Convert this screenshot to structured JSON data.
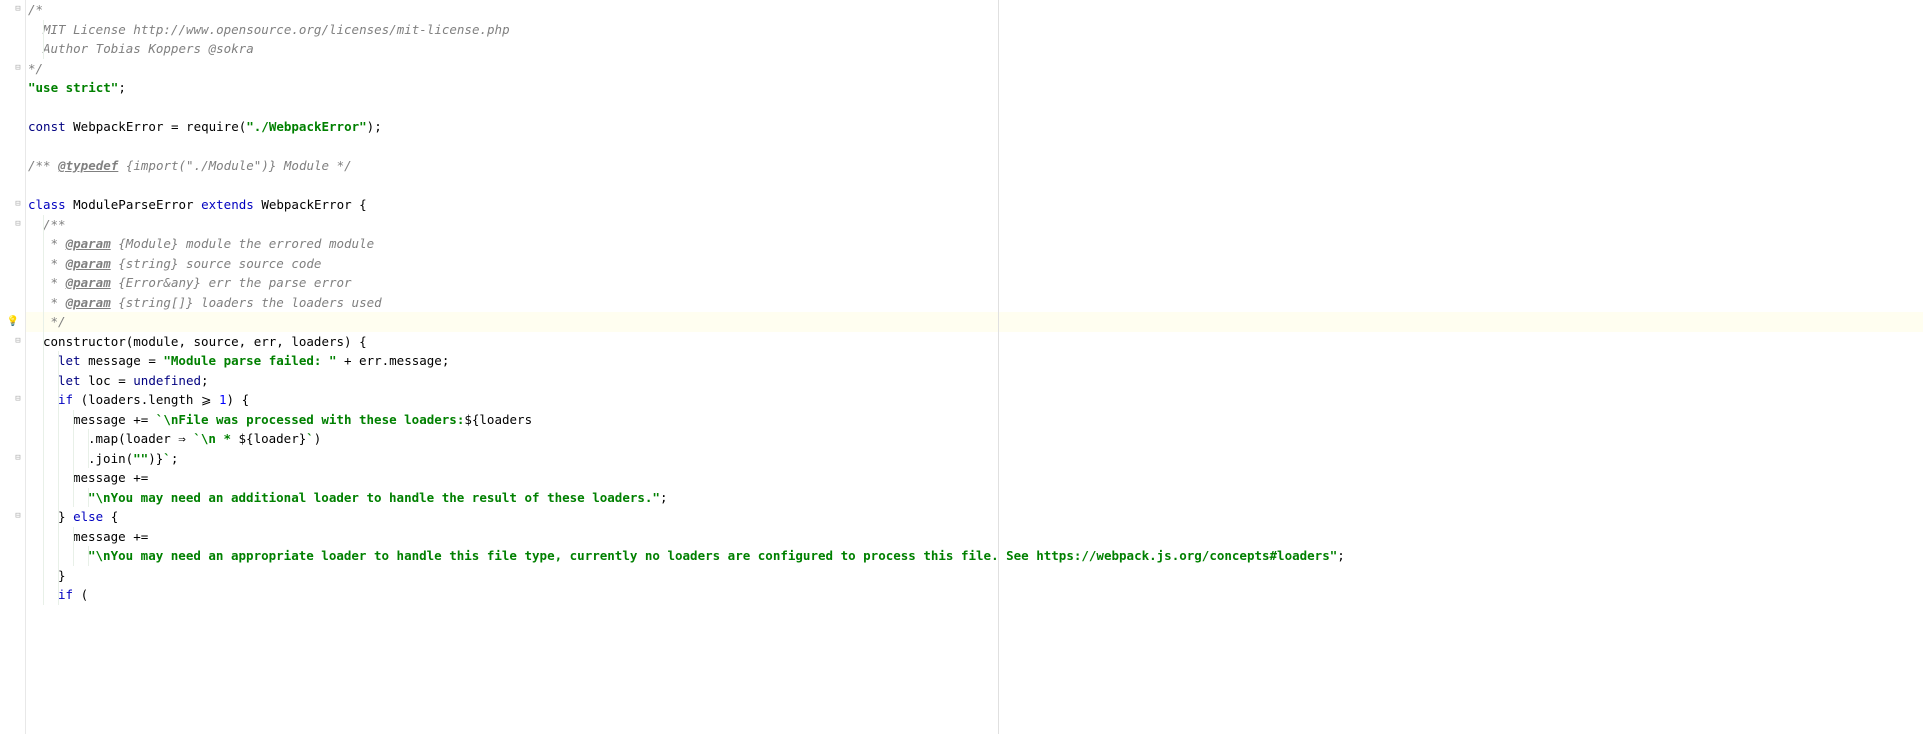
{
  "gutter_bulb_line": 16,
  "lines": [
    {
      "indent": 0,
      "fold": true,
      "tokens": [
        {
          "t": "/*",
          "c": "c-comment"
        }
      ]
    },
    {
      "indent": 1,
      "tokens": [
        {
          "t": "MIT License http://www.opensource.org/licenses/mit-license.php",
          "c": "c-comment"
        }
      ]
    },
    {
      "indent": 1,
      "tokens": [
        {
          "t": "Author Tobias Koppers @sokra",
          "c": "c-comment"
        }
      ]
    },
    {
      "indent": 0,
      "fold": true,
      "tokens": [
        {
          "t": "*/",
          "c": "c-comment"
        }
      ]
    },
    {
      "indent": 0,
      "tokens": [
        {
          "t": "\"use strict\"",
          "c": "c-string"
        },
        {
          "t": ";",
          "c": "c-normal"
        }
      ]
    },
    {
      "indent": 0,
      "tokens": []
    },
    {
      "indent": 0,
      "tokens": [
        {
          "t": "const ",
          "c": "c-keyword2"
        },
        {
          "t": "WebpackError = require(",
          "c": "c-normal"
        },
        {
          "t": "\"./WebpackError\"",
          "c": "c-string"
        },
        {
          "t": ");",
          "c": "c-normal"
        }
      ]
    },
    {
      "indent": 0,
      "tokens": []
    },
    {
      "indent": 0,
      "tokens": [
        {
          "t": "/** ",
          "c": "c-doc"
        },
        {
          "t": "@typedef",
          "c": "c-doctag"
        },
        {
          "t": " {import(\"./Module\")} Module */",
          "c": "c-doc"
        }
      ]
    },
    {
      "indent": 0,
      "tokens": []
    },
    {
      "indent": 0,
      "fold": true,
      "tokens": [
        {
          "t": "class ",
          "c": "c-keyword"
        },
        {
          "t": "ModuleParseError ",
          "c": "c-normal"
        },
        {
          "t": "extends ",
          "c": "c-keyword"
        },
        {
          "t": "WebpackError {",
          "c": "c-normal"
        }
      ]
    },
    {
      "indent": 1,
      "fold": true,
      "tokens": [
        {
          "t": "/**",
          "c": "c-doc"
        }
      ]
    },
    {
      "indent": 1,
      "tokens": [
        {
          "t": " * ",
          "c": "c-doc"
        },
        {
          "t": "@param",
          "c": "c-doctag"
        },
        {
          "t": " {Module} module ",
          "c": "c-doc"
        },
        {
          "t": "the errored module",
          "c": "c-docparam"
        }
      ]
    },
    {
      "indent": 1,
      "tokens": [
        {
          "t": " * ",
          "c": "c-doc"
        },
        {
          "t": "@param",
          "c": "c-doctag"
        },
        {
          "t": " {string} source ",
          "c": "c-doc"
        },
        {
          "t": "source code",
          "c": "c-docparam"
        }
      ]
    },
    {
      "indent": 1,
      "tokens": [
        {
          "t": " * ",
          "c": "c-doc"
        },
        {
          "t": "@param",
          "c": "c-doctag"
        },
        {
          "t": " {Error&any} err ",
          "c": "c-doc"
        },
        {
          "t": "the parse error",
          "c": "c-docparam"
        }
      ]
    },
    {
      "indent": 1,
      "tokens": [
        {
          "t": " * ",
          "c": "c-doc"
        },
        {
          "t": "@param",
          "c": "c-doctag"
        },
        {
          "t": " {string[]} loaders ",
          "c": "c-doc"
        },
        {
          "t": "the loaders used",
          "c": "c-docparam"
        }
      ]
    },
    {
      "indent": 1,
      "highlight": true,
      "bulb": true,
      "tokens": [
        {
          "t": " */",
          "c": "c-doc"
        }
      ]
    },
    {
      "indent": 1,
      "fold": true,
      "tokens": [
        {
          "t": "constructor(module, source, err, loaders) {",
          "c": "c-normal"
        }
      ]
    },
    {
      "indent": 2,
      "tokens": [
        {
          "t": "let ",
          "c": "c-keyword2"
        },
        {
          "t": "message = ",
          "c": "c-normal"
        },
        {
          "t": "\"Module parse failed: \"",
          "c": "c-string"
        },
        {
          "t": " + err.message;",
          "c": "c-normal"
        }
      ]
    },
    {
      "indent": 2,
      "tokens": [
        {
          "t": "let ",
          "c": "c-keyword2"
        },
        {
          "t": "loc = ",
          "c": "c-normal"
        },
        {
          "t": "undefined",
          "c": "c-undef"
        },
        {
          "t": ";",
          "c": "c-normal"
        }
      ]
    },
    {
      "indent": 2,
      "fold": true,
      "tokens": [
        {
          "t": "if ",
          "c": "c-keyword"
        },
        {
          "t": "(loaders.length ⩾ ",
          "c": "c-normal"
        },
        {
          "t": "1",
          "c": "c-num"
        },
        {
          "t": ") {",
          "c": "c-normal"
        }
      ]
    },
    {
      "indent": 3,
      "tokens": [
        {
          "t": "message += ",
          "c": "c-normal"
        },
        {
          "t": "`\\nFile was processed with these loaders:",
          "c": "c-string"
        },
        {
          "t": "${loaders",
          "c": "c-normal"
        }
      ]
    },
    {
      "indent": 4,
      "tokens": [
        {
          "t": ".map(loader ⇒ ",
          "c": "c-normal"
        },
        {
          "t": "`\\n * ",
          "c": "c-string"
        },
        {
          "t": "${loader}",
          "c": "c-normal"
        },
        {
          "t": "`",
          "c": "c-string"
        },
        {
          "t": ")",
          "c": "c-normal"
        }
      ]
    },
    {
      "indent": 4,
      "fold": true,
      "tokens": [
        {
          "t": ".join(",
          "c": "c-normal"
        },
        {
          "t": "\"\"",
          "c": "c-string"
        },
        {
          "t": ")}",
          "c": "c-normal"
        },
        {
          "t": "`",
          "c": "c-string"
        },
        {
          "t": ";",
          "c": "c-normal"
        }
      ]
    },
    {
      "indent": 3,
      "tokens": [
        {
          "t": "message +=",
          "c": "c-normal"
        }
      ]
    },
    {
      "indent": 4,
      "tokens": [
        {
          "t": "\"\\nYou may need an additional loader to handle the result of these loaders.\"",
          "c": "c-string"
        },
        {
          "t": ";",
          "c": "c-normal"
        }
      ]
    },
    {
      "indent": 2,
      "fold": true,
      "tokens": [
        {
          "t": "} ",
          "c": "c-normal"
        },
        {
          "t": "else ",
          "c": "c-keyword"
        },
        {
          "t": "{",
          "c": "c-normal"
        }
      ]
    },
    {
      "indent": 3,
      "tokens": [
        {
          "t": "message +=",
          "c": "c-normal"
        }
      ]
    },
    {
      "indent": 4,
      "tokens": [
        {
          "t": "\"\\nYou may need an appropriate loader to handle this file type, currently no loaders are configured to process this file. See https://webpack.js.org/concepts#loaders\"",
          "c": "c-string"
        },
        {
          "t": ";",
          "c": "c-normal"
        }
      ]
    },
    {
      "indent": 2,
      "tokens": [
        {
          "t": "}",
          "c": "c-normal"
        }
      ]
    },
    {
      "indent": 2,
      "tokens": [
        {
          "t": "if ",
          "c": "c-keyword"
        },
        {
          "t": "(",
          "c": "c-normal"
        }
      ]
    }
  ],
  "indent_width": 15,
  "fold_glyph": "⊟",
  "bulb_glyph": "●"
}
